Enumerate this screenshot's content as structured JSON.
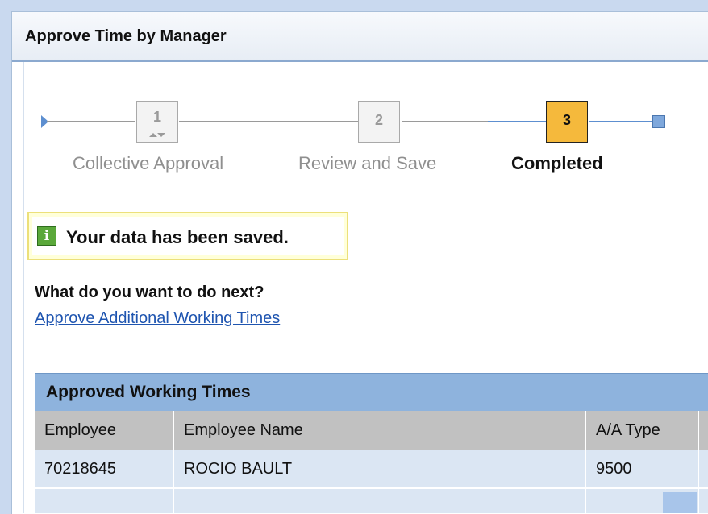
{
  "window": {
    "title": "Approve Time by Manager"
  },
  "stepper": {
    "steps": [
      {
        "number": "1",
        "label": "Collective Approval",
        "state": "done"
      },
      {
        "number": "2",
        "label": "Review and Save",
        "state": "done"
      },
      {
        "number": "3",
        "label": "Completed",
        "state": "current"
      }
    ]
  },
  "message": {
    "icon": "info-icon",
    "icon_glyph": "i",
    "text": "Your data has been saved."
  },
  "next": {
    "question": "What do you want to do next?",
    "link": "Approve Additional Working Times"
  },
  "table": {
    "title": "Approved Working Times",
    "columns": [
      "Employee",
      "Employee Name",
      "A/A Type"
    ],
    "rows": [
      [
        "70218645",
        "ROCIO BAULT",
        "9500"
      ]
    ]
  },
  "colors": {
    "accent": "#8eb3dd",
    "active_step": "#f5b93c",
    "success_icon": "#5aa83a",
    "link": "#1f55b0"
  }
}
